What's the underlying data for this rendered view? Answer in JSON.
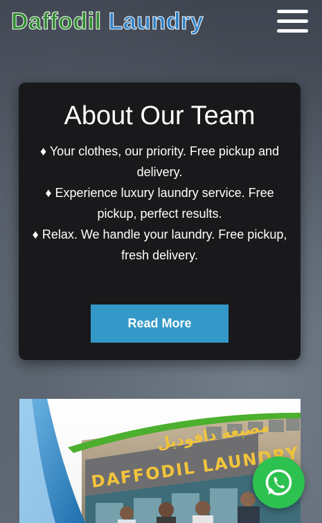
{
  "brand": {
    "word1": "Daffodil",
    "word2": "Laundry",
    "color1": "#2e8b2e",
    "color2": "#2d7fc4"
  },
  "menu": {
    "icon": "hamburger-menu-icon"
  },
  "about": {
    "title": "About Our Team",
    "lines": [
      "♦ Your clothes, our priority. Free pickup and delivery.",
      "♦ Experience luxury laundry service. Free pickup, perfect results.",
      "♦ Relax. We handle your laundry. Free pickup, fresh delivery."
    ],
    "button_label": "Read More",
    "button_color": "#3499c8"
  },
  "photo": {
    "sign_arabic": "مصبغة دافوديل",
    "sign_english": "DAFFODIL LAUNDRY"
  },
  "whatsapp": {
    "icon": "whatsapp-icon",
    "color": "#2dc14f"
  }
}
